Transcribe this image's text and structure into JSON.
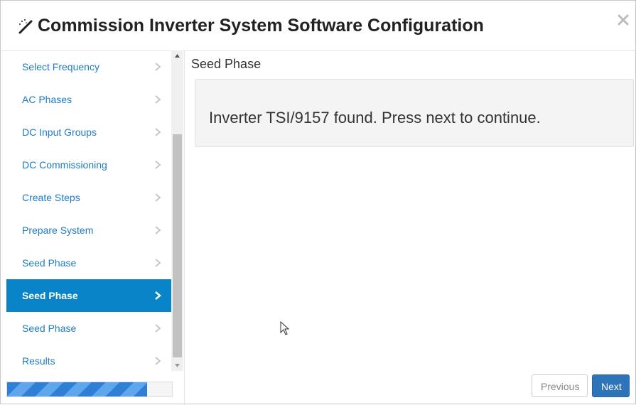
{
  "dialog": {
    "title": "Commission Inverter System Software Configuration",
    "title_icon": "magic-wand-icon",
    "close_icon": "close-icon"
  },
  "sidebar": {
    "items": [
      {
        "label": "Select Frequency",
        "active": false
      },
      {
        "label": "AC Phases",
        "active": false
      },
      {
        "label": "DC Input Groups",
        "active": false
      },
      {
        "label": "DC Commissioning",
        "active": false
      },
      {
        "label": "Create Steps",
        "active": false
      },
      {
        "label": "Prepare System",
        "active": false
      },
      {
        "label": "Seed Phase",
        "active": false
      },
      {
        "label": "Seed Phase",
        "active": true
      },
      {
        "label": "Seed Phase",
        "active": false
      },
      {
        "label": "Results",
        "active": false
      }
    ],
    "chevron_icon": "chevron-right-icon"
  },
  "progress": {
    "fraction": 0.85
  },
  "content": {
    "title": "Seed Phase",
    "message": "Inverter TSI/9157 found. Press next to continue."
  },
  "footer": {
    "previous_label": "Previous",
    "next_label": "Next"
  },
  "colors": {
    "accent": "#0a84c8",
    "link": "#1e7bc6",
    "next_button": "#2e74b9"
  }
}
